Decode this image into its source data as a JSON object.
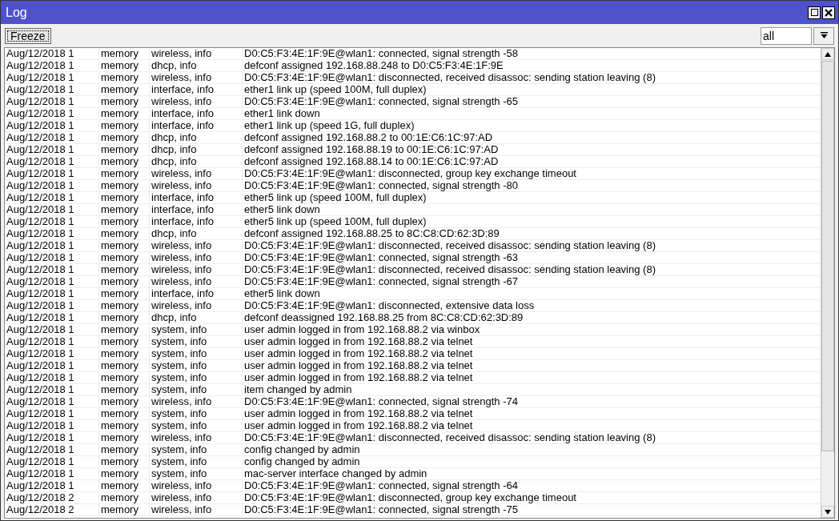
{
  "window": {
    "title": "Log"
  },
  "toolbar": {
    "freeze_button": "Freeze",
    "filter": {
      "value": "all"
    }
  },
  "rows": [
    {
      "time": "Aug/12/2018 1",
      "buffer": "memory",
      "topics": "wireless, info",
      "message": "D0:C5:F3:4E:1F:9E@wlan1: connected, signal strength -58"
    },
    {
      "time": "Aug/12/2018 1",
      "buffer": "memory",
      "topics": "dhcp, info",
      "message": "defconf assigned 192.168.88.248 to D0:C5:F3:4E:1F:9E"
    },
    {
      "time": "Aug/12/2018 1",
      "buffer": "memory",
      "topics": "wireless, info",
      "message": "D0:C5:F3:4E:1F:9E@wlan1: disconnected, received disassoc: sending station leaving (8)"
    },
    {
      "time": "Aug/12/2018 1",
      "buffer": "memory",
      "topics": "interface, info",
      "message": "ether1 link up (speed 100M, full duplex)"
    },
    {
      "time": "Aug/12/2018 1",
      "buffer": "memory",
      "topics": "wireless, info",
      "message": "D0:C5:F3:4E:1F:9E@wlan1: connected, signal strength -65"
    },
    {
      "time": "Aug/12/2018 1",
      "buffer": "memory",
      "topics": "interface, info",
      "message": "ether1 link down"
    },
    {
      "time": "Aug/12/2018 1",
      "buffer": "memory",
      "topics": "interface, info",
      "message": "ether1 link up (speed 1G, full duplex)"
    },
    {
      "time": "Aug/12/2018 1",
      "buffer": "memory",
      "topics": "dhcp, info",
      "message": "defconf assigned 192.168.88.2 to 00:1E:C6:1C:97:AD"
    },
    {
      "time": "Aug/12/2018 1",
      "buffer": "memory",
      "topics": "dhcp, info",
      "message": "defconf assigned 192.168.88.19 to 00:1E:C6:1C:97:AD"
    },
    {
      "time": "Aug/12/2018 1",
      "buffer": "memory",
      "topics": "dhcp, info",
      "message": "defconf assigned 192.168.88.14 to 00:1E:C6:1C:97:AD"
    },
    {
      "time": "Aug/12/2018 1",
      "buffer": "memory",
      "topics": "wireless, info",
      "message": "D0:C5:F3:4E:1F:9E@wlan1: disconnected, group key exchange timeout"
    },
    {
      "time": "Aug/12/2018 1",
      "buffer": "memory",
      "topics": "wireless, info",
      "message": "D0:C5:F3:4E:1F:9E@wlan1: connected, signal strength -80"
    },
    {
      "time": "Aug/12/2018 1",
      "buffer": "memory",
      "topics": "interface, info",
      "message": "ether5 link up (speed 100M, full duplex)"
    },
    {
      "time": "Aug/12/2018 1",
      "buffer": "memory",
      "topics": "interface, info",
      "message": "ether5 link down"
    },
    {
      "time": "Aug/12/2018 1",
      "buffer": "memory",
      "topics": "interface, info",
      "message": "ether5 link up (speed 100M, full duplex)"
    },
    {
      "time": "Aug/12/2018 1",
      "buffer": "memory",
      "topics": "dhcp, info",
      "message": "defconf assigned 192.168.88.25 to 8C:C8:CD:62:3D:89"
    },
    {
      "time": "Aug/12/2018 1",
      "buffer": "memory",
      "topics": "wireless, info",
      "message": "D0:C5:F3:4E:1F:9E@wlan1: disconnected, received disassoc: sending station leaving (8)"
    },
    {
      "time": "Aug/12/2018 1",
      "buffer": "memory",
      "topics": "wireless, info",
      "message": "D0:C5:F3:4E:1F:9E@wlan1: connected, signal strength -63"
    },
    {
      "time": "Aug/12/2018 1",
      "buffer": "memory",
      "topics": "wireless, info",
      "message": "D0:C5:F3:4E:1F:9E@wlan1: disconnected, received disassoc: sending station leaving (8)"
    },
    {
      "time": "Aug/12/2018 1",
      "buffer": "memory",
      "topics": "wireless, info",
      "message": "D0:C5:F3:4E:1F:9E@wlan1: connected, signal strength -67"
    },
    {
      "time": "Aug/12/2018 1",
      "buffer": "memory",
      "topics": "interface, info",
      "message": "ether5 link down"
    },
    {
      "time": "Aug/12/2018 1",
      "buffer": "memory",
      "topics": "wireless, info",
      "message": "D0:C5:F3:4E:1F:9E@wlan1: disconnected, extensive data loss"
    },
    {
      "time": "Aug/12/2018 1",
      "buffer": "memory",
      "topics": "dhcp, info",
      "message": "defconf deassigned 192.168.88.25 from 8C:C8:CD:62:3D:89"
    },
    {
      "time": "Aug/12/2018 1",
      "buffer": "memory",
      "topics": "system, info",
      "message": "user admin logged in from 192.168.88.2 via winbox"
    },
    {
      "time": "Aug/12/2018 1",
      "buffer": "memory",
      "topics": "system, info",
      "message": "user admin logged in from 192.168.88.2 via telnet"
    },
    {
      "time": "Aug/12/2018 1",
      "buffer": "memory",
      "topics": "system, info",
      "message": "user admin logged in from 192.168.88.2 via telnet"
    },
    {
      "time": "Aug/12/2018 1",
      "buffer": "memory",
      "topics": "system, info",
      "message": "user admin logged in from 192.168.88.2 via telnet"
    },
    {
      "time": "Aug/12/2018 1",
      "buffer": "memory",
      "topics": "system, info",
      "message": "user admin logged in from 192.168.88.2 via telnet"
    },
    {
      "time": "Aug/12/2018 1",
      "buffer": "memory",
      "topics": "system, info",
      "message": "item changed by admin"
    },
    {
      "time": "Aug/12/2018 1",
      "buffer": "memory",
      "topics": "wireless, info",
      "message": "D0:C5:F3:4E:1F:9E@wlan1: connected, signal strength -74"
    },
    {
      "time": "Aug/12/2018 1",
      "buffer": "memory",
      "topics": "system, info",
      "message": "user admin logged in from 192.168.88.2 via telnet"
    },
    {
      "time": "Aug/12/2018 1",
      "buffer": "memory",
      "topics": "system, info",
      "message": "user admin logged in from 192.168.88.2 via telnet"
    },
    {
      "time": "Aug/12/2018 1",
      "buffer": "memory",
      "topics": "wireless, info",
      "message": "D0:C5:F3:4E:1F:9E@wlan1: disconnected, received disassoc: sending station leaving (8)"
    },
    {
      "time": "Aug/12/2018 1",
      "buffer": "memory",
      "topics": "system, info",
      "message": "config changed by admin"
    },
    {
      "time": "Aug/12/2018 1",
      "buffer": "memory",
      "topics": "system, info",
      "message": "config changed by admin"
    },
    {
      "time": "Aug/12/2018 1",
      "buffer": "memory",
      "topics": "system, info",
      "message": "mac-server interface changed by admin"
    },
    {
      "time": "Aug/12/2018 1",
      "buffer": "memory",
      "topics": "wireless, info",
      "message": "D0:C5:F3:4E:1F:9E@wlan1: connected, signal strength -64"
    },
    {
      "time": "Aug/12/2018 2",
      "buffer": "memory",
      "topics": "wireless, info",
      "message": "D0:C5:F3:4E:1F:9E@wlan1: disconnected, group key exchange timeout"
    },
    {
      "time": "Aug/12/2018 2",
      "buffer": "memory",
      "topics": "wireless, info",
      "message": "D0:C5:F3:4E:1F:9E@wlan1: connected, signal strength -75"
    }
  ]
}
